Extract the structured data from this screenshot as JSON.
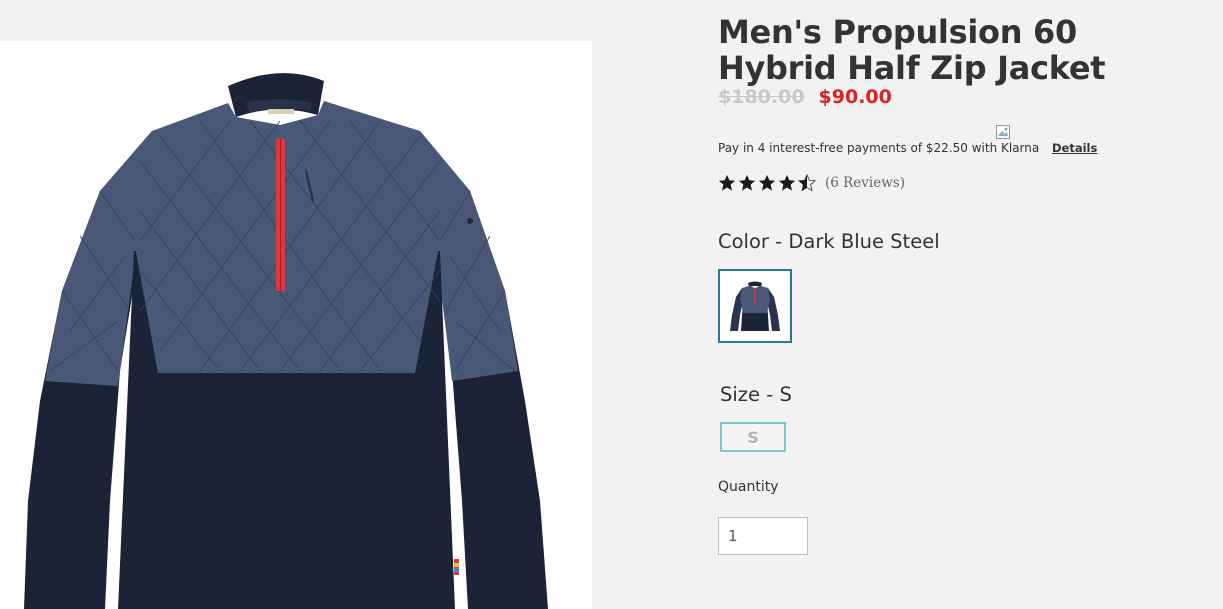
{
  "product": {
    "title": "Men's Propulsion 60 Hybrid Half Zip Jacket",
    "image_alt": "Men's Propulsion 60 Hybrid Half Zip Jacket in Dark Blue Steel",
    "price_original": "$180.00",
    "price_sale": "$90.00"
  },
  "klarna": {
    "text": "Pay in 4 interest-free payments of $22.50 with Klarna",
    "details_label": "Details",
    "image_alt": "Klarna"
  },
  "rating": {
    "value": 4.5,
    "max": 5,
    "reviews_label": "(6 Reviews)"
  },
  "color": {
    "label": "Color",
    "separator": " - ",
    "value": "Dark Blue Steel"
  },
  "size": {
    "label": "Size",
    "separator": " - ",
    "value": "S",
    "options": [
      "S"
    ]
  },
  "quantity": {
    "label": "Quantity",
    "value": "1"
  },
  "colors": {
    "background": "#f2f2f2",
    "sale_price": "#e0201f",
    "swatch_border": "#1f7c9a",
    "size_border": "#7ac8d0",
    "jacket_navy": "#1b2337",
    "jacket_quilt": "#4a5878",
    "zip_red": "#e8333a"
  }
}
